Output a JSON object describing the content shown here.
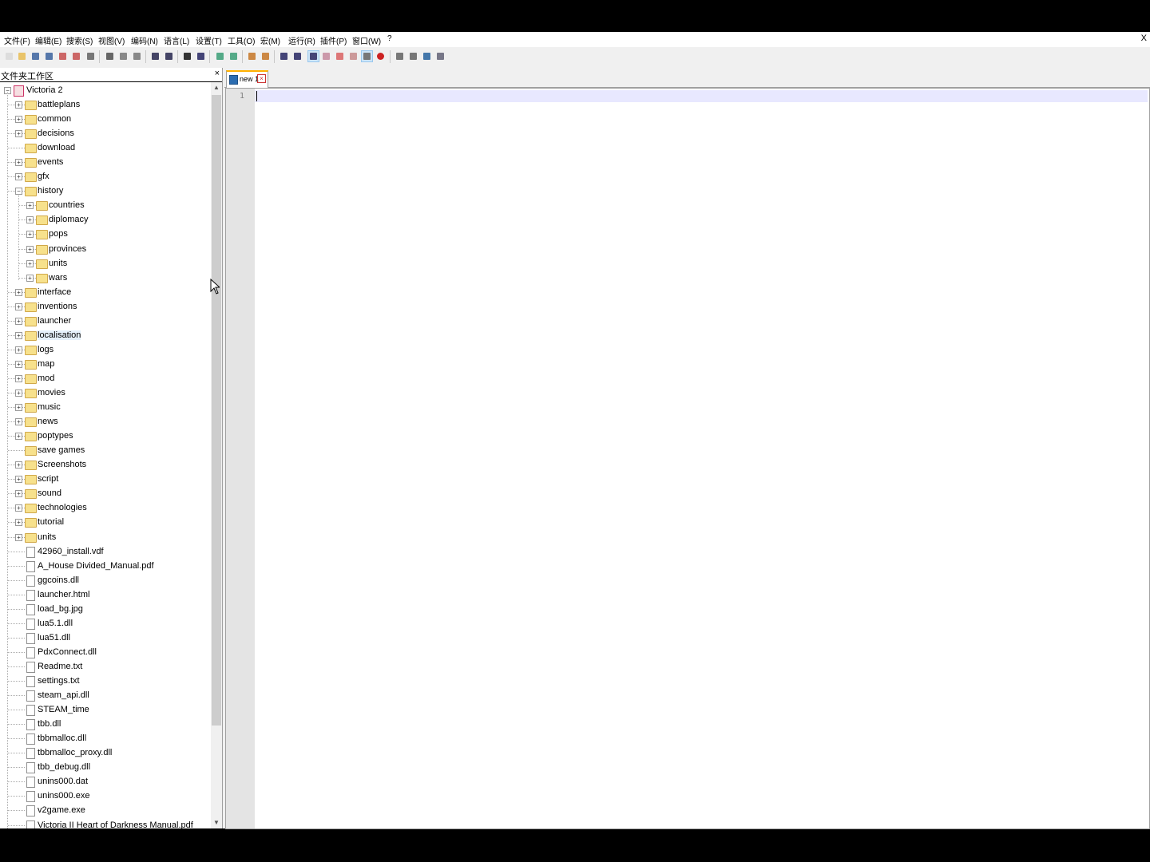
{
  "menu": {
    "items": [
      "文件(F)",
      "编辑(E)",
      "搜索(S)",
      "视图(V)",
      "编码(N)",
      "语言(L)",
      "设置(T)",
      "工具(O)",
      "宏(M)",
      "运行(R)",
      "插件(P)",
      "窗口(W)",
      "?"
    ],
    "close": "X"
  },
  "toolbar": {
    "icons": [
      "new-file-icon",
      "open-file-icon",
      "save-icon",
      "save-all-icon",
      "close-icon",
      "close-all-icon",
      "print-icon",
      "cut-icon",
      "copy-icon",
      "paste-icon",
      "undo-icon",
      "redo-icon",
      "find-icon",
      "replace-icon",
      "zoom-in-icon",
      "zoom-out-icon",
      "sync-vertical-icon",
      "sync-horizontal-icon",
      "word-wrap-icon",
      "show-all-chars-icon",
      "indent-guide-icon",
      "function-list-icon",
      "document-map-icon",
      "folder-workspace-icon",
      "monitoring-icon",
      "record-macro-icon",
      "stop-macro-icon",
      "play-macro-icon",
      "run-macro-multiple-icon",
      "save-macro-icon"
    ]
  },
  "panel": {
    "title": "文件夹工作区",
    "close": "×"
  },
  "tree": {
    "root": "Victoria 2",
    "items": [
      {
        "label": "battleplans",
        "kind": "folder",
        "level": 1,
        "expandable": true
      },
      {
        "label": "common",
        "kind": "folder",
        "level": 1,
        "expandable": true
      },
      {
        "label": "decisions",
        "kind": "folder",
        "level": 1,
        "expandable": true
      },
      {
        "label": "download",
        "kind": "folder",
        "level": 1,
        "expandable": false
      },
      {
        "label": "events",
        "kind": "folder",
        "level": 1,
        "expandable": true
      },
      {
        "label": "gfx",
        "kind": "folder",
        "level": 1,
        "expandable": true
      },
      {
        "label": "history",
        "kind": "folder",
        "level": 1,
        "expandable": true,
        "expanded": true
      },
      {
        "label": "countries",
        "kind": "folder",
        "level": 2,
        "expandable": true
      },
      {
        "label": "diplomacy",
        "kind": "folder",
        "level": 2,
        "expandable": true
      },
      {
        "label": "pops",
        "kind": "folder",
        "level": 2,
        "expandable": true
      },
      {
        "label": "provinces",
        "kind": "folder",
        "level": 2,
        "expandable": true
      },
      {
        "label": "units",
        "kind": "folder",
        "level": 2,
        "expandable": true
      },
      {
        "label": "wars",
        "kind": "folder",
        "level": 2,
        "expandable": true
      },
      {
        "label": "interface",
        "kind": "folder",
        "level": 1,
        "expandable": true
      },
      {
        "label": "inventions",
        "kind": "folder",
        "level": 1,
        "expandable": true
      },
      {
        "label": "launcher",
        "kind": "folder",
        "level": 1,
        "expandable": true
      },
      {
        "label": "localisation",
        "kind": "folder",
        "level": 1,
        "expandable": true,
        "hover": true
      },
      {
        "label": "logs",
        "kind": "folder",
        "level": 1,
        "expandable": true
      },
      {
        "label": "map",
        "kind": "folder",
        "level": 1,
        "expandable": true
      },
      {
        "label": "mod",
        "kind": "folder",
        "level": 1,
        "expandable": true
      },
      {
        "label": "movies",
        "kind": "folder",
        "level": 1,
        "expandable": true
      },
      {
        "label": "music",
        "kind": "folder",
        "level": 1,
        "expandable": true
      },
      {
        "label": "news",
        "kind": "folder",
        "level": 1,
        "expandable": true
      },
      {
        "label": "poptypes",
        "kind": "folder",
        "level": 1,
        "expandable": true
      },
      {
        "label": "save games",
        "kind": "folder",
        "level": 1,
        "expandable": false
      },
      {
        "label": "Screenshots",
        "kind": "folder",
        "level": 1,
        "expandable": true
      },
      {
        "label": "script",
        "kind": "folder",
        "level": 1,
        "expandable": true
      },
      {
        "label": "sound",
        "kind": "folder",
        "level": 1,
        "expandable": true
      },
      {
        "label": "technologies",
        "kind": "folder",
        "level": 1,
        "expandable": true
      },
      {
        "label": "tutorial",
        "kind": "folder",
        "level": 1,
        "expandable": true
      },
      {
        "label": "units",
        "kind": "folder",
        "level": 1,
        "expandable": true
      },
      {
        "label": "42960_install.vdf",
        "kind": "file",
        "level": 1
      },
      {
        "label": "A_House Divided_Manual.pdf",
        "kind": "file",
        "level": 1
      },
      {
        "label": "ggcoins.dll",
        "kind": "file",
        "level": 1
      },
      {
        "label": "launcher.html",
        "kind": "file",
        "level": 1
      },
      {
        "label": "load_bg.jpg",
        "kind": "file",
        "level": 1
      },
      {
        "label": "lua5.1.dll",
        "kind": "file",
        "level": 1
      },
      {
        "label": "lua51.dll",
        "kind": "file",
        "level": 1
      },
      {
        "label": "PdxConnect.dll",
        "kind": "file",
        "level": 1
      },
      {
        "label": "Readme.txt",
        "kind": "file",
        "level": 1
      },
      {
        "label": "settings.txt",
        "kind": "file",
        "level": 1
      },
      {
        "label": "steam_api.dll",
        "kind": "file",
        "level": 1
      },
      {
        "label": "STEAM_time",
        "kind": "file",
        "level": 1
      },
      {
        "label": "tbb.dll",
        "kind": "file",
        "level": 1
      },
      {
        "label": "tbbmalloc.dll",
        "kind": "file",
        "level": 1
      },
      {
        "label": "tbbmalloc_proxy.dll",
        "kind": "file",
        "level": 1
      },
      {
        "label": "tbb_debug.dll",
        "kind": "file",
        "level": 1
      },
      {
        "label": "unins000.dat",
        "kind": "file",
        "level": 1
      },
      {
        "label": "unins000.exe",
        "kind": "file",
        "level": 1
      },
      {
        "label": "v2game.exe",
        "kind": "file",
        "level": 1
      },
      {
        "label": "Victoria II Heart of Darkness Manual.pdf",
        "kind": "file",
        "level": 1
      }
    ]
  },
  "editor": {
    "tab_label": "new 1",
    "line_numbers": [
      "1"
    ],
    "colors": {
      "current_line": "#e8e8ff",
      "tab_accent": "#ffb000"
    }
  }
}
